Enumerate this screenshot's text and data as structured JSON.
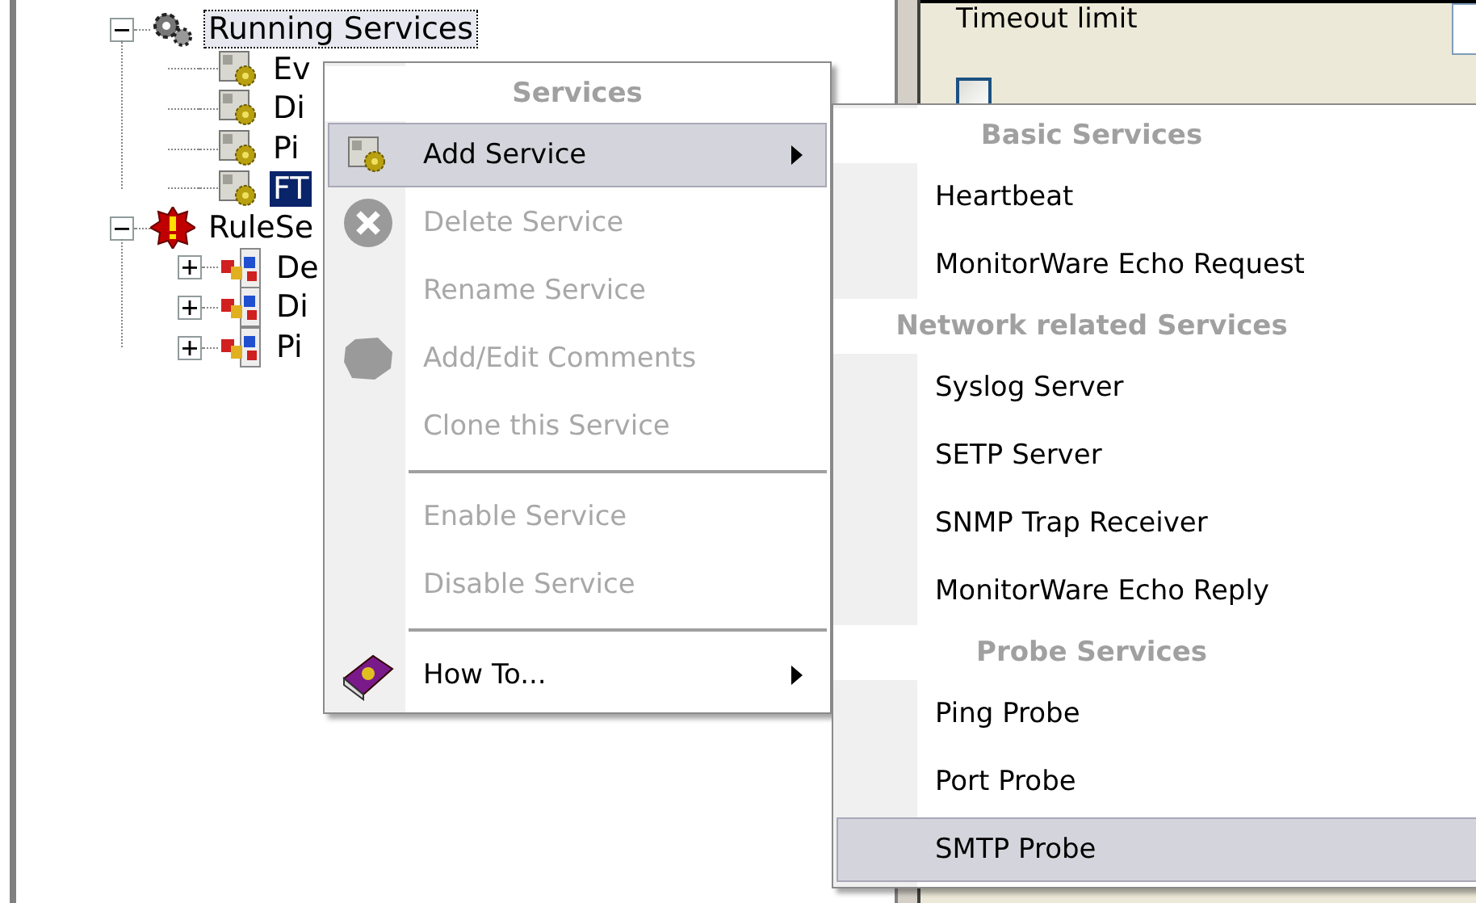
{
  "tree": [
    {
      "label": "Running Services",
      "kind": "group",
      "expanded": true,
      "selected": false,
      "focused": true,
      "children": [
        {
          "label": "Ev",
          "kind": "service",
          "selected": false
        },
        {
          "label": "Di",
          "kind": "service",
          "selected": false
        },
        {
          "label": "Pi",
          "kind": "service",
          "selected": false
        },
        {
          "label": "FT",
          "kind": "service",
          "selected": true
        }
      ]
    },
    {
      "label": "RuleSe",
      "kind": "ruleset",
      "expanded": true,
      "selected": false,
      "focused": false,
      "children": [
        {
          "label": "De",
          "kind": "rule",
          "expanded": false,
          "selected": false
        },
        {
          "label": "Di",
          "kind": "rule",
          "expanded": false,
          "selected": false
        },
        {
          "label": "Pi",
          "kind": "rule",
          "expanded": false,
          "selected": false
        }
      ]
    }
  ],
  "settings": {
    "timeout_label": "Timeout limit",
    "event_checkbox": {
      "checked": false
    }
  },
  "context_menu": {
    "title": "Services",
    "items": [
      {
        "kind": "item",
        "label": "Add Service",
        "disabled": false,
        "selected": true,
        "submenu": true
      },
      {
        "kind": "item",
        "label": "Delete Service",
        "disabled": true,
        "selected": false,
        "submenu": false
      },
      {
        "kind": "item",
        "label": "Rename Service",
        "disabled": true,
        "selected": false,
        "submenu": false
      },
      {
        "kind": "item",
        "label": "Add/Edit Comments",
        "disabled": true,
        "selected": false,
        "submenu": false
      },
      {
        "kind": "item",
        "label": "Clone this Service",
        "disabled": true,
        "selected": false,
        "submenu": false
      },
      {
        "kind": "separator"
      },
      {
        "kind": "item",
        "label": "Enable Service",
        "disabled": true,
        "selected": false,
        "submenu": false
      },
      {
        "kind": "item",
        "label": "Disable Service",
        "disabled": true,
        "selected": false,
        "submenu": false
      },
      {
        "kind": "separator"
      },
      {
        "kind": "item",
        "label": "How To...",
        "disabled": false,
        "selected": false,
        "submenu": true
      }
    ]
  },
  "submenu": {
    "items": [
      {
        "kind": "heading",
        "label": "Basic Services"
      },
      {
        "kind": "item",
        "label": "Heartbeat",
        "selected": false
      },
      {
        "kind": "item",
        "label": "MonitorWare Echo Request",
        "selected": false
      },
      {
        "kind": "heading",
        "label": "Network related Services"
      },
      {
        "kind": "item",
        "label": "Syslog Server",
        "selected": false
      },
      {
        "kind": "item",
        "label": "SETP Server",
        "selected": false
      },
      {
        "kind": "item",
        "label": "SNMP Trap Receiver",
        "selected": false
      },
      {
        "kind": "item",
        "label": "MonitorWare Echo Reply",
        "selected": false
      },
      {
        "kind": "heading",
        "label": "Probe Services"
      },
      {
        "kind": "item",
        "label": "Ping Probe",
        "selected": false
      },
      {
        "kind": "item",
        "label": "Port Probe",
        "selected": false
      },
      {
        "kind": "item",
        "label": "SMTP Probe",
        "selected": true
      }
    ]
  }
}
